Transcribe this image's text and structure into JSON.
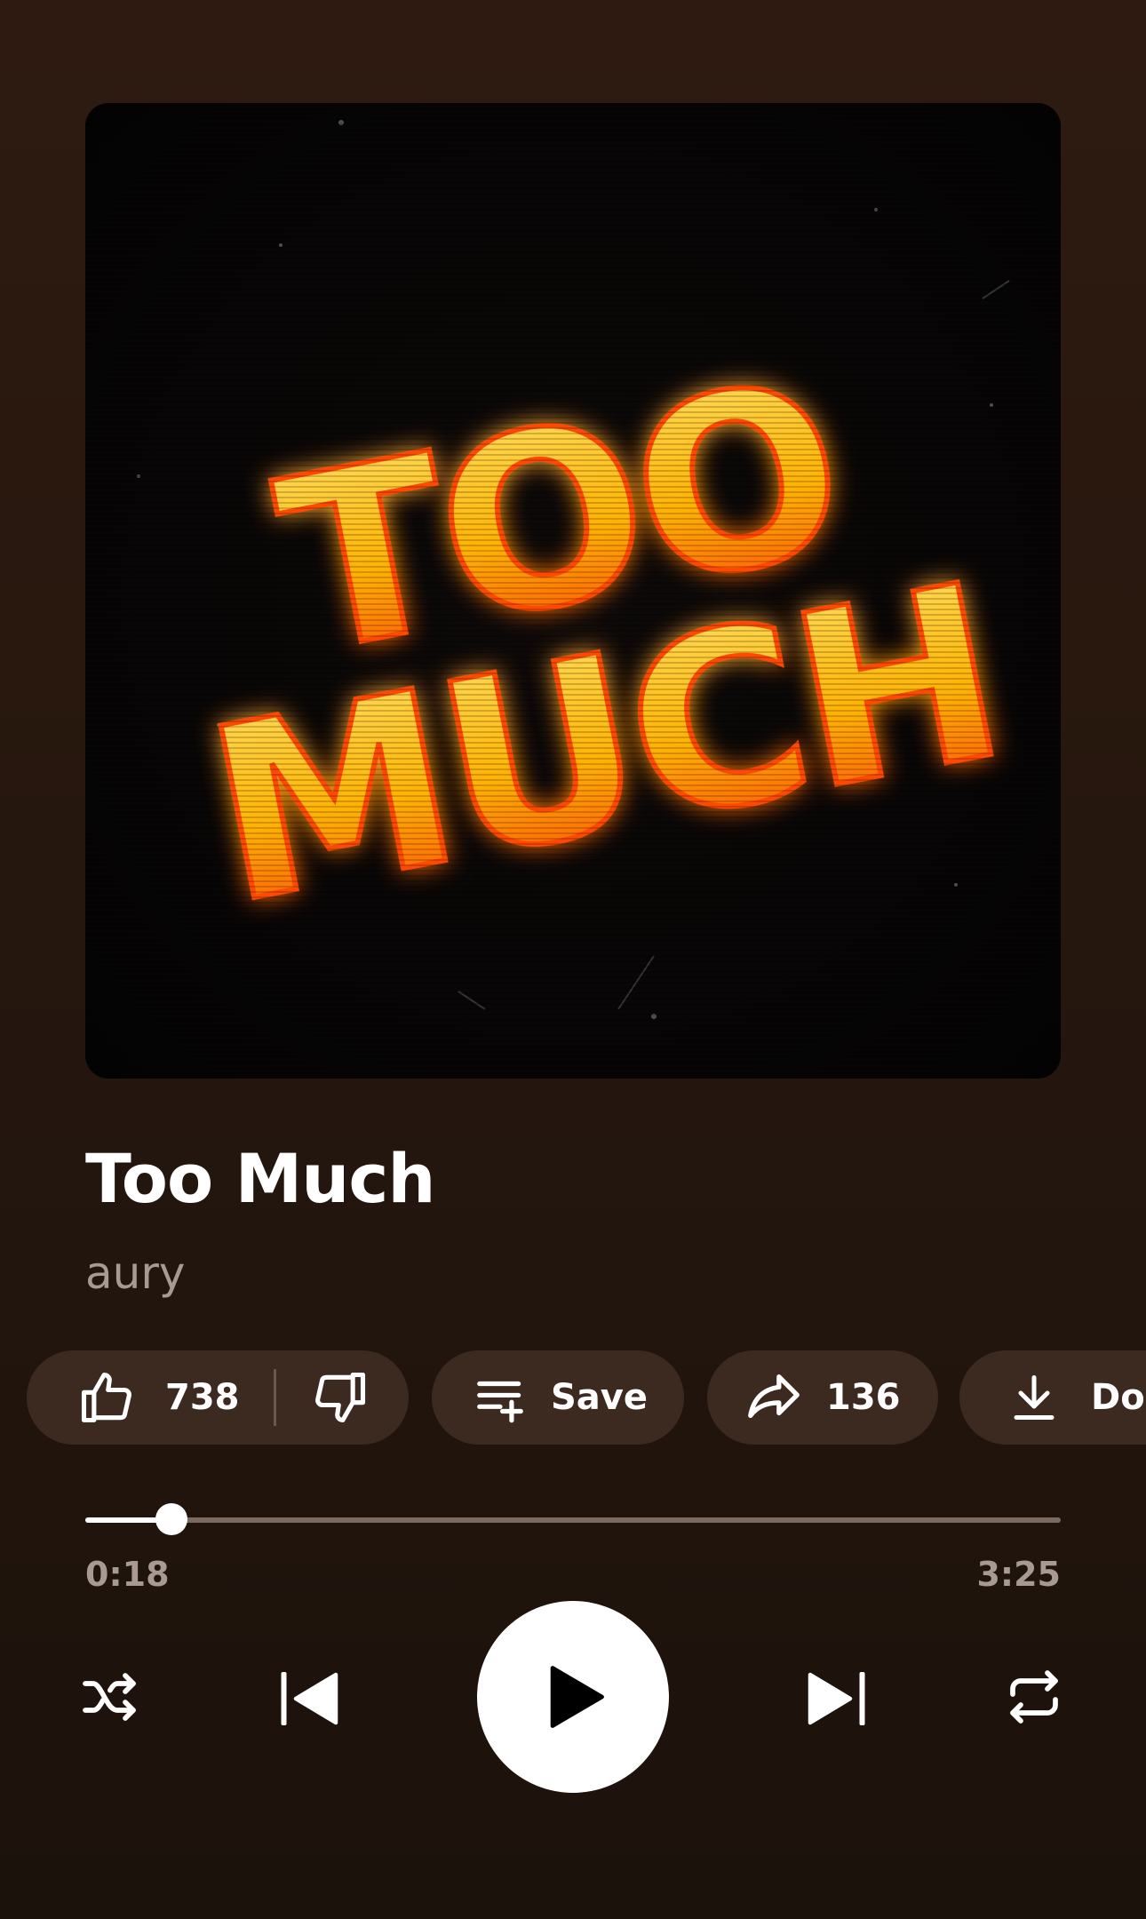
{
  "album_art": {
    "text_line1": "TOO",
    "text_line2": "MUCH",
    "glow_colors": [
      "#ff3d00",
      "#ffb300",
      "#ffe36b"
    ]
  },
  "track": {
    "title": "Too Much",
    "artist": "aury"
  },
  "actions": {
    "likes": "738",
    "save_label": "Save",
    "shares": "136",
    "download_label": "Download"
  },
  "playback": {
    "current_time": "0:18",
    "total_time": "3:25",
    "progress_fraction": 0.088,
    "state": "paused"
  },
  "controls": {
    "icons": [
      "shuffle-icon",
      "previous-icon",
      "play-icon",
      "next-icon",
      "repeat-icon"
    ]
  },
  "colors": {
    "background": "#26170e",
    "pill": "#3c2a21",
    "secondary_text": "#a89a90"
  }
}
